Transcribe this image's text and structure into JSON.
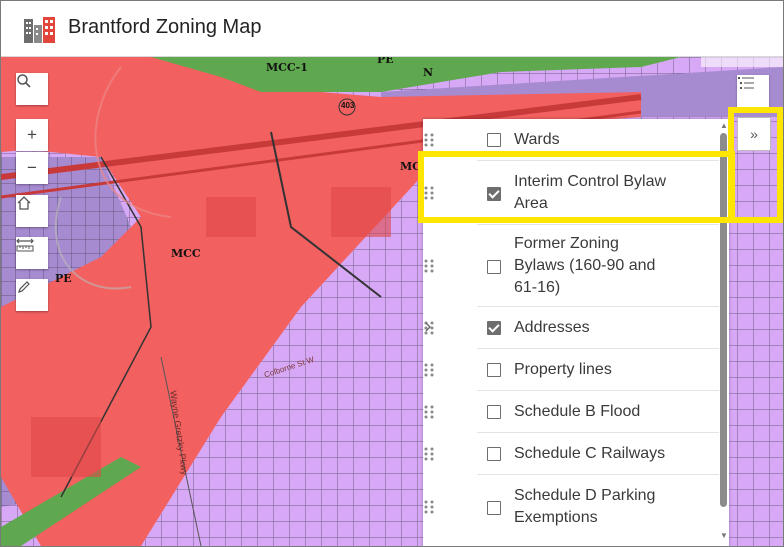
{
  "app": {
    "title": "Brantford Zoning Map"
  },
  "map": {
    "zone_labels": [
      "MCC-1",
      "PE",
      "N",
      "MCC",
      "MC",
      "PE"
    ],
    "road_labels": [
      "Wayne Gretzky Pkwy",
      "Colborne St W",
      "403"
    ],
    "colors": {
      "commercial_red": "#f26060",
      "residential_purple": "#a78bd1",
      "light_purple": "#d7a8f5",
      "green": "#5fa84f",
      "highlight_yellow": "#ffe600"
    }
  },
  "toolbar": {
    "buttons": [
      {
        "icon": "search-icon"
      },
      {
        "icon": "zoom-in-icon",
        "symbol": "+"
      },
      {
        "icon": "zoom-out-icon",
        "symbol": "−"
      },
      {
        "icon": "home-icon"
      },
      {
        "icon": "measure-icon"
      },
      {
        "icon": "draw-icon"
      }
    ],
    "layer_list_icon": "layer-list-icon",
    "collapse_symbol": "»"
  },
  "layers": [
    {
      "label": "Wards",
      "checked": false,
      "expandable": false
    },
    {
      "label": "Interim Control Bylaw Area",
      "checked": true,
      "expandable": false,
      "highlighted": true
    },
    {
      "label": "Former Zoning Bylaws (160-90 and 61-16)",
      "checked": false,
      "expandable": false
    },
    {
      "label": "Addresses",
      "checked": true,
      "expandable": true
    },
    {
      "label": "Property lines",
      "checked": false,
      "expandable": false
    },
    {
      "label": "Schedule B Flood",
      "checked": false,
      "expandable": false
    },
    {
      "label": "Schedule C Railways",
      "checked": false,
      "expandable": false
    },
    {
      "label": "Schedule D Parking Exemptions",
      "checked": false,
      "expandable": false
    }
  ],
  "labels_split": {
    "interim_line1": "Interim Control Bylaw",
    "interim_line2": "Area",
    "former_line1": "Former Zoning",
    "former_line2": "Bylaws (160-90 and",
    "former_line3": "61-16)",
    "parking_line1": "Schedule D Parking",
    "parking_line2": "Exemptions"
  }
}
